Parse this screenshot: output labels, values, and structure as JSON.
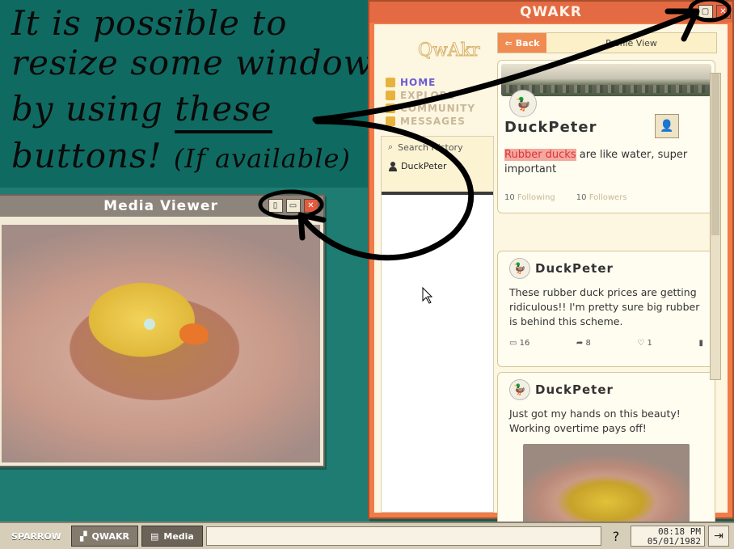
{
  "annotation": {
    "line1": "It is possible to",
    "line2": "resize some windows",
    "line3_prefix": "by using",
    "line3_emph": "these",
    "line4_main": "buttons!",
    "line4_note": "(If available)"
  },
  "qwakr": {
    "title": "QWAKR",
    "logo": "QwAkr",
    "nav": [
      "HOME",
      "EXPLORE",
      "COMMUNITY",
      "MESSAGES"
    ],
    "search_label": "Search History",
    "history_item": "DuckPeter",
    "back_label": "Back",
    "topbar_title": "Profile View",
    "profile": {
      "name": "DuckPeter",
      "bio_highlight": "Rubber ducks",
      "bio_rest": " are like water, super important",
      "following_count": "10",
      "following_label": "Following",
      "followers_count": "10",
      "followers_label": "Followers"
    },
    "posts": [
      {
        "author": "DuckPeter",
        "text": "These rubber duck prices are getting ridiculous!! I'm pretty sure big rubber is behind this scheme.",
        "comments": "16",
        "reposts": "8",
        "likes": "1"
      },
      {
        "author": "DuckPeter",
        "text": "Just got my hands on this beauty! Working overtime pays off!"
      }
    ]
  },
  "media": {
    "title": "Media Viewer"
  },
  "taskbar": {
    "start": "SPARROW",
    "task1": "QWAKR",
    "task2": "Media",
    "help": "?",
    "time": "08:18 PM",
    "date": "05/01/1982"
  },
  "colors": {
    "desktop": "#1e7c72",
    "qwakr_frame": "#f07c4a",
    "qwakr_nav_active": "#6b5bd6",
    "bio_highlight": "#f4a8a0"
  }
}
